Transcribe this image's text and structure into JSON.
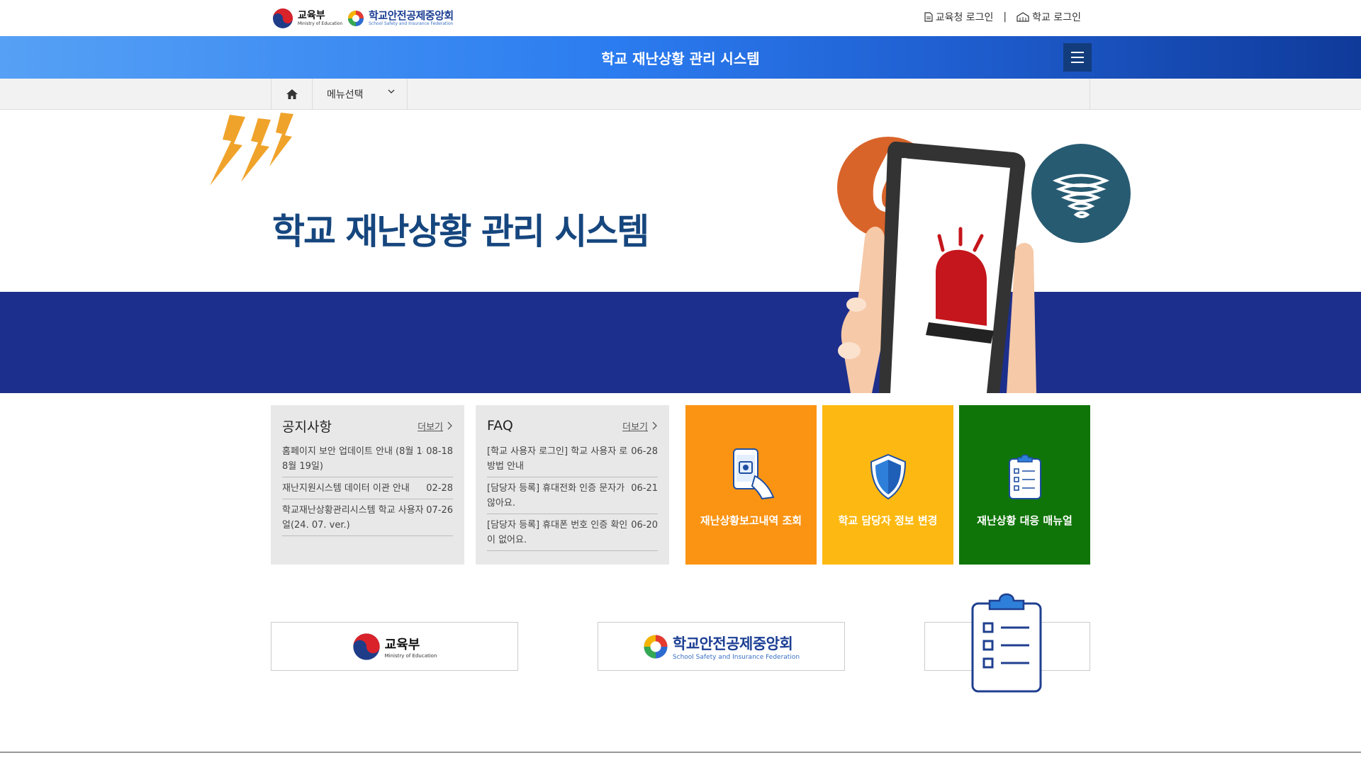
{
  "header": {
    "moe_logo": {
      "ko": "교육부",
      "en": "Ministry of Education"
    },
    "ssif_logo": {
      "ko": "학교안전공제중앙회",
      "en": "School Safety and Insurance Federation"
    },
    "links": [
      {
        "label": "교육청 로그인",
        "icon": "document-icon"
      },
      {
        "label": "학교 로그인",
        "icon": "school-icon"
      }
    ],
    "separator": "|"
  },
  "titlebar": {
    "title": "학교 재난상황 관리 시스템",
    "menu_icon": "hamburger-icon"
  },
  "subnav": {
    "home_icon": "home-icon",
    "menu_select": "메뉴선택"
  },
  "hero": {
    "title": "학교 재난상황 관리 시스템"
  },
  "notice": {
    "title": "공지사항",
    "more": "더보기",
    "items": [
      {
        "text": "홈페이지 보안 업데이트 안내 (8월 18일 ~ 8월 19일)",
        "date": "08-18"
      },
      {
        "text": "재난지원시스템 데이터 이관 안내",
        "date": "02-28"
      },
      {
        "text": "학교재난상황관리시스템 학교 사용자 매뉴얼(24. 07. ver.)",
        "date": "07-26"
      }
    ]
  },
  "faq": {
    "title": "FAQ",
    "more": "더보기",
    "items": [
      {
        "text": "[학교 사용자 로그인] 학교 사용자 로그인 방법 안내",
        "date": "06-28"
      },
      {
        "text": "[담당자 등록] 휴대전화 인증 문자가 오지 않아요.",
        "date": "06-21"
      },
      {
        "text": "[담당자 등록] 휴대폰 번호 인증 확인 버튼이 없어요.",
        "date": "06-20"
      }
    ]
  },
  "tiles": [
    {
      "label": "재난상황보고내역 조회",
      "icon": "phone-report-icon",
      "color": "#fb9413"
    },
    {
      "label": "학교 담당자 정보 변경",
      "icon": "shield-icon",
      "color": "#fdb912"
    },
    {
      "label": "재난상황 대응 매뉴얼",
      "icon": "clipboard-icon",
      "color": "#107508"
    }
  ],
  "footer_logos": [
    {
      "ko": "교육부",
      "en": "Ministry of Education"
    },
    {
      "ko": "학교안전공제중앙회",
      "en": "School Safety and Insurance Federation"
    }
  ],
  "colors": {
    "primary_blue": "#1d2f8c",
    "title_navy": "#16467e",
    "orange": "#fb9413",
    "yellow": "#fdb912",
    "green": "#107508"
  }
}
